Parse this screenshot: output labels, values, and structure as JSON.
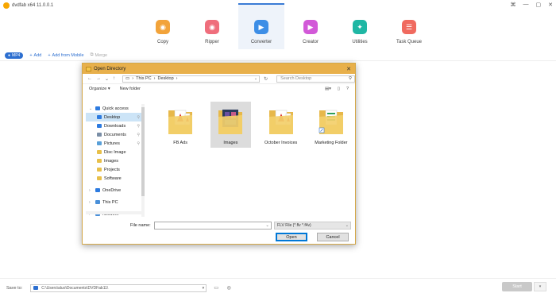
{
  "titlebar": {
    "title": "dvdfab x64  11.0.0.1",
    "controls": [
      "⌘",
      "—",
      "▢",
      "✕"
    ]
  },
  "toolbar": {
    "items": [
      {
        "label": "Copy",
        "icon": "copy-icon",
        "color": "#f2a33a",
        "glyph": "◉"
      },
      {
        "label": "Ripper",
        "icon": "ripper-icon",
        "color": "#ef6e7c",
        "glyph": "◉"
      },
      {
        "label": "Converter",
        "icon": "converter-icon",
        "color": "#3d8ee6",
        "glyph": "▶",
        "active": true
      },
      {
        "label": "Creator",
        "icon": "creator-icon",
        "color": "#d259d8",
        "glyph": "▶"
      },
      {
        "label": "Utilities",
        "icon": "utilities-icon",
        "color": "#1fb7a4",
        "glyph": "✦"
      },
      {
        "label": "Task Queue",
        "icon": "task-queue-icon",
        "color": "#f06a5f",
        "glyph": "☰"
      }
    ]
  },
  "subbar": {
    "profile": "MP4",
    "add": "Add",
    "add_mobile": "Add from Mobile",
    "merge": "Merge"
  },
  "bottom": {
    "save_to": "Save to:",
    "path": "C:\\Users\\aluo\\Documents\\DVDFab11\\",
    "start": "Start"
  },
  "dialog": {
    "title": "Open Directory",
    "address": {
      "crumbs": [
        "This PC",
        "Desktop"
      ]
    },
    "search_placeholder": "Search Desktop",
    "organize": "Organize ▾",
    "new_folder": "New folder",
    "sidebar": [
      {
        "label": "Quick access",
        "icon": "star-icon",
        "level": 0,
        "expanded": true,
        "color": "#2d7be0"
      },
      {
        "label": "Desktop",
        "icon": "desktop-folder-icon",
        "level": 1,
        "selected": true,
        "pinned": true,
        "color": "#2d7be0"
      },
      {
        "label": "Downloads",
        "icon": "downloads-folder-icon",
        "level": 1,
        "pinned": true,
        "color": "#2d7be0"
      },
      {
        "label": "Documents",
        "icon": "documents-folder-icon",
        "level": 1,
        "pinned": true,
        "color": "#7a8ea6"
      },
      {
        "label": "Pictures",
        "icon": "pictures-folder-icon",
        "level": 1,
        "pinned": true,
        "color": "#5aa0d8"
      },
      {
        "label": "Disc Image",
        "icon": "folder-icon",
        "level": 1,
        "color": "#e8c04a"
      },
      {
        "label": "Images",
        "icon": "folder-icon",
        "level": 1,
        "color": "#e8c04a"
      },
      {
        "label": "Projects",
        "icon": "folder-icon",
        "level": 1,
        "color": "#e8c04a"
      },
      {
        "label": "Software",
        "icon": "folder-icon",
        "level": 1,
        "color": "#e8c04a"
      },
      {
        "label": "",
        "icon": "",
        "level": -1
      },
      {
        "label": "OneDrive",
        "icon": "onedrive-icon",
        "level": 0,
        "color": "#2d7be0"
      },
      {
        "label": "",
        "icon": "",
        "level": -1
      },
      {
        "label": "This PC",
        "icon": "this-pc-icon",
        "level": 0,
        "color": "#4a90d9"
      },
      {
        "label": "",
        "icon": "",
        "level": -1
      },
      {
        "label": "Network",
        "icon": "network-icon",
        "level": 0,
        "color": "#4a90d9"
      }
    ],
    "files": [
      {
        "label": "FB Ads",
        "kind": "pdf-folder"
      },
      {
        "label": "Images",
        "kind": "image-folder",
        "selected": true
      },
      {
        "label": "October Invoices",
        "kind": "pdf-folder"
      },
      {
        "label": "Marketing Folder",
        "kind": "sheet-folder",
        "shortcut": true
      }
    ],
    "file_name_label": "File name:",
    "file_name_value": "",
    "filter": "FLV File (*.flv *.f4v)",
    "open": "Open",
    "cancel": "Cancel"
  }
}
